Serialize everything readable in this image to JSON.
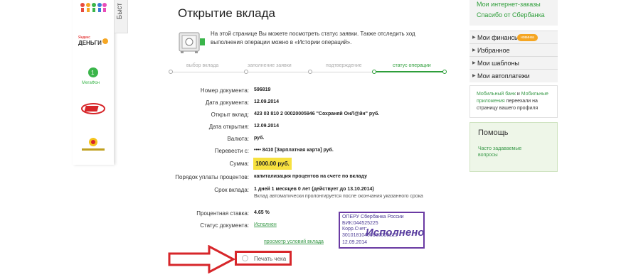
{
  "left_sidebar": {
    "tab_label": "Быст",
    "logos": [
      {
        "name": "Яндекс Деньги",
        "caption": "Яндекс ДЕНЬГИ"
      },
      {
        "name": "МегаФон",
        "caption": "МегаФон"
      }
    ]
  },
  "page": {
    "title": "Открытие вклада",
    "intro": "На этой странице Вы можете посмотреть статус заявки. Также отследить ход выполнения операции можно в «Истории операций»."
  },
  "steps": [
    {
      "label": "выбор вклада",
      "active": false
    },
    {
      "label": "заполнение заявки",
      "active": false
    },
    {
      "label": "подтверждение",
      "active": false
    },
    {
      "label": "статус операции",
      "active": true
    }
  ],
  "details": [
    {
      "label": "Номер документа:",
      "value": "596819"
    },
    {
      "label": "Дата документа:",
      "value": "12.09.2014"
    },
    {
      "label": "Открыт вклад:",
      "value": "423 03 810 2 00020005946  \"Сохраняй ОнЛ@йн\"  руб."
    },
    {
      "label": "Дата открытия:",
      "value": "12.09.2014"
    },
    {
      "label": "Валюта:",
      "value": "руб."
    },
    {
      "label": "Перевести с:",
      "value": "•••• 8410  [Зарплатная карта]  руб."
    },
    {
      "label": "Сумма:",
      "value": "1000.00 руб."
    },
    {
      "label": "Порядок уплаты процентов:",
      "value": "капитализация процентов на счете по вкладу"
    },
    {
      "label": "Срок вклада:",
      "value": "1 дней 1 месяцев 0 лет (действует до 13.10.2014)",
      "note": "Вклад автоматически пролонгируется после окончания указанного срока"
    },
    {
      "label": "Процентная ставка:",
      "value": "4.65 %"
    },
    {
      "label": "Статус документа:",
      "value": "Исполнен"
    }
  ],
  "links": {
    "view_terms": "просмотр условий вклада",
    "print_receipt": "Печать чека"
  },
  "stamp": {
    "line1": "ОПЕРУ Сбербанка России",
    "line2": "БИК:044525225",
    "line3": "Корр.Счет: 30101810400000000225",
    "big": "Исполнено",
    "date": "12.09.2014"
  },
  "right_sidebar": {
    "top_links": [
      "Мои интернет-заказы",
      "Спасибо от Сбербанка"
    ],
    "menu": [
      {
        "label": "Мои финансы",
        "badge": "новинка"
      },
      {
        "label": "Избранное"
      },
      {
        "label": "Мои шаблоны"
      },
      {
        "label": "Мои автоплатежи"
      }
    ],
    "info": {
      "part1": "Мобильный банк",
      "part2": " и ",
      "part3": "Мобильные приложения",
      "part4": " переехали на страницу вашего профиля"
    },
    "help": {
      "title": "Помощь",
      "faq": "Часто задаваемые вопросы"
    }
  },
  "colors": {
    "accent": "#2e9e3a",
    "highlight": "#f7e13f",
    "annotation": "#d7262a",
    "stamp": "#6a3aa3"
  }
}
